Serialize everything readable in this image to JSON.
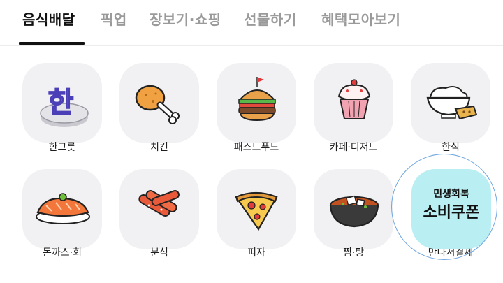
{
  "tabs": [
    {
      "label": "음식배달",
      "active": true
    },
    {
      "label": "픽업",
      "active": false
    },
    {
      "label": "장보기·쇼핑",
      "active": false
    },
    {
      "label": "선물하기",
      "active": false
    },
    {
      "label": "혜택모아보기",
      "active": false
    }
  ],
  "categories": [
    {
      "label": "한그릇",
      "icon": "hangeureut-icon"
    },
    {
      "label": "치킨",
      "icon": "chicken-drumstick-icon"
    },
    {
      "label": "패스트푸드",
      "icon": "burger-icon"
    },
    {
      "label": "카페·디저트",
      "icon": "cupcake-icon"
    },
    {
      "label": "한식",
      "icon": "rice-bowl-icon"
    },
    {
      "label": "돈까스·회",
      "icon": "salmon-sushi-icon"
    },
    {
      "label": "분식",
      "icon": "tteokbokki-icon"
    },
    {
      "label": "피자",
      "icon": "pizza-slice-icon"
    },
    {
      "label": "찜·탕",
      "icon": "stew-pot-icon"
    },
    {
      "label": "만나서결제",
      "icon": "coupon-icon"
    }
  ],
  "coupon": {
    "line1": "민생회복",
    "line2": "소비쿠폰"
  },
  "han_char": "한",
  "colors": {
    "active_tab": "#111111",
    "inactive_tab": "#9a9a9a",
    "tile_bg": "#f1f1f3",
    "coupon_bg": "#b9eef2",
    "circle_annotation": "#6fa6e0"
  }
}
